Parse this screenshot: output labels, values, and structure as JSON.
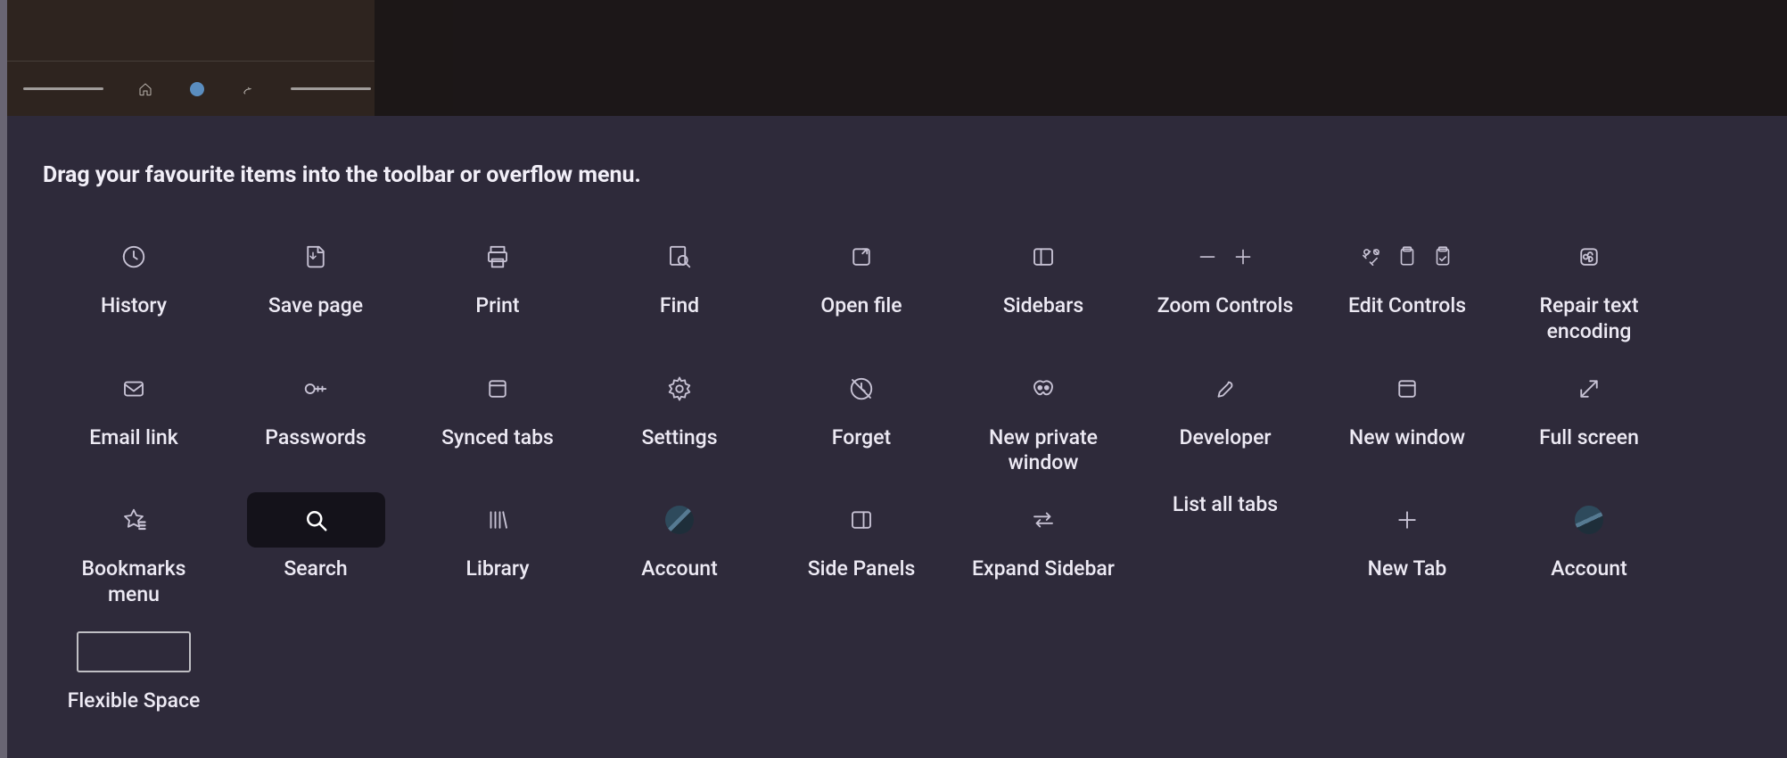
{
  "heading": "Drag your favourite items into the toolbar or overflow menu.",
  "toolbar_icons": [
    "home-icon",
    "globe-icon",
    "connection-icon"
  ],
  "items": [
    {
      "key": "history",
      "label": "History"
    },
    {
      "key": "save-page",
      "label": "Save page"
    },
    {
      "key": "print",
      "label": "Print"
    },
    {
      "key": "find",
      "label": "Find"
    },
    {
      "key": "open-file",
      "label": "Open file"
    },
    {
      "key": "sidebars",
      "label": "Sidebars"
    },
    {
      "key": "zoom-controls",
      "label": "Zoom Controls"
    },
    {
      "key": "edit-controls",
      "label": "Edit Controls"
    },
    {
      "key": "repair-text-encoding",
      "label": "Repair text encoding"
    },
    {
      "key": "email-link",
      "label": "Email link"
    },
    {
      "key": "passwords",
      "label": "Passwords"
    },
    {
      "key": "synced-tabs",
      "label": "Synced tabs"
    },
    {
      "key": "settings",
      "label": "Settings"
    },
    {
      "key": "forget",
      "label": "Forget"
    },
    {
      "key": "new-private-window",
      "label": "New private window"
    },
    {
      "key": "developer",
      "label": "Developer"
    },
    {
      "key": "new-window",
      "label": "New window"
    },
    {
      "key": "full-screen",
      "label": "Full screen"
    },
    {
      "key": "bookmarks-menu",
      "label": "Bookmarks menu"
    },
    {
      "key": "search",
      "label": "Search"
    },
    {
      "key": "library",
      "label": "Library"
    },
    {
      "key": "account",
      "label": "Account"
    },
    {
      "key": "side-panels",
      "label": "Side Panels"
    },
    {
      "key": "expand-sidebar",
      "label": "Expand Sidebar"
    },
    {
      "key": "list-all-tabs",
      "label": "List all tabs"
    },
    {
      "key": "new-tab",
      "label": "New Tab"
    },
    {
      "key": "account-2",
      "label": "Account"
    },
    {
      "key": "flexible-space",
      "label": "Flexible Space"
    }
  ]
}
